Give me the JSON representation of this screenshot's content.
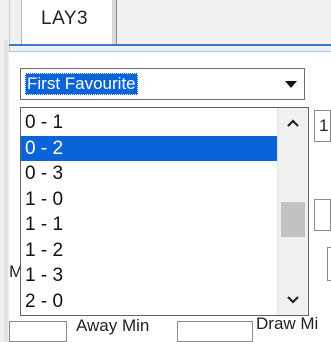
{
  "tab": {
    "label": "LAY3"
  },
  "combo": {
    "selected_text": "First Favourite"
  },
  "dropdown": {
    "items": [
      {
        "label": "0 - 1"
      },
      {
        "label": "0 - 2",
        "selected": true
      },
      {
        "label": "0 - 3"
      },
      {
        "label": "1 - 0"
      },
      {
        "label": "1 - 1"
      },
      {
        "label": "1 - 2"
      },
      {
        "label": "1 - 3"
      },
      {
        "label": "2 - 0"
      }
    ],
    "scroll_position": 0.45
  },
  "background": {
    "partial_field_value": "1",
    "partial_label_m": "M",
    "away_min_label": "Away Min",
    "draw_min_label": "Draw Mi"
  },
  "icons": {
    "combo_arrow": "chevron-down-icon",
    "scroll_up": "chevron-up-icon",
    "scroll_down": "chevron-down-icon"
  },
  "colors": {
    "selection": "#0a64d7",
    "frame_accent": "#3a78d1"
  }
}
